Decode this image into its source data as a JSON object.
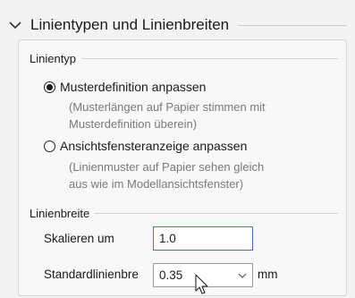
{
  "section": {
    "title": "Linientypen und Linienbreiten"
  },
  "linientyp": {
    "group_label": "Linientyp",
    "options": [
      {
        "label": "Musterdefinition anpassen",
        "selected": true,
        "hint_line1": "(Musterlängen auf Papier stimmen mit",
        "hint_line2": "Musterdefinition überein)"
      },
      {
        "label": "Ansichtsfensteranzeige anpassen",
        "selected": false,
        "hint_line1": "(Linienmuster auf Papier sehen gleich",
        "hint_line2": "aus wie im Modellansichtsfenster)"
      }
    ]
  },
  "linienbreite": {
    "group_label": "Linienbreite",
    "scale_label": "Skalieren um",
    "scale_value": "1.0",
    "default_label": "Standardlinienbre",
    "default_value": "0.35",
    "unit": "mm"
  }
}
